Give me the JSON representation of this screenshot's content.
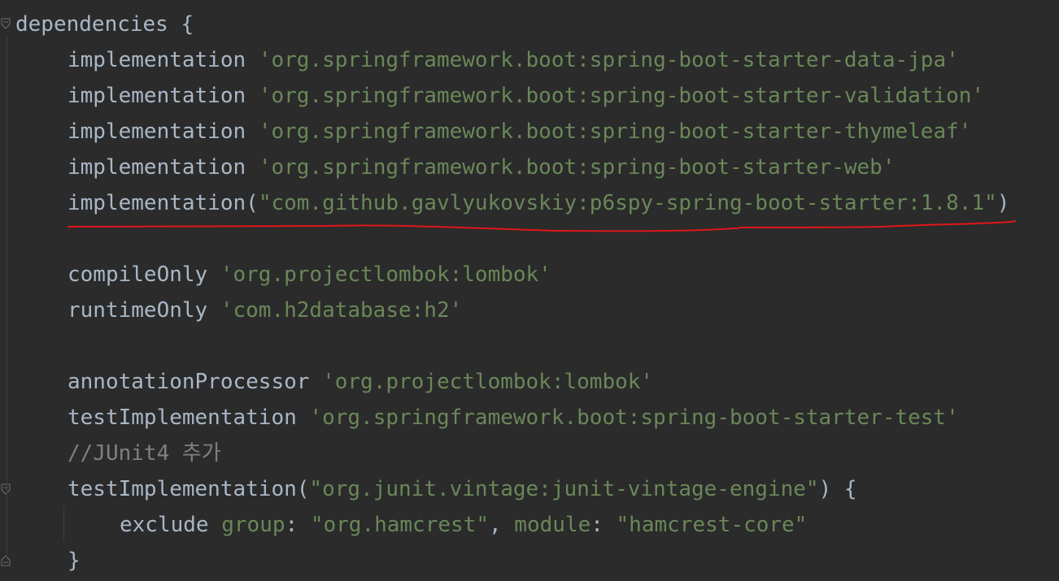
{
  "code": {
    "line1": {
      "ident": "dependencies",
      "brace": " {"
    },
    "deps": [
      {
        "fn": "implementation",
        "str": "'org.springframework.boot:spring-boot-starter-data-jpa'"
      },
      {
        "fn": "implementation",
        "str": "'org.springframework.boot:spring-boot-starter-validation'"
      },
      {
        "fn": "implementation",
        "str": "'org.springframework.boot:spring-boot-starter-thymeleaf'"
      },
      {
        "fn": "implementation",
        "str": "'org.springframework.boot:spring-boot-starter-web'"
      }
    ],
    "p6spy": {
      "fn": "implementation",
      "open": "(",
      "str": "\"com.github.gavlyukovskiy:p6spy-spring-boot-starter:1.8.1\"",
      "close": ")"
    },
    "compileOnly": {
      "fn": "compileOnly",
      "str": "'org.projectlombok:lombok'"
    },
    "runtimeOnly": {
      "fn": "runtimeOnly",
      "str": "'com.h2database:h2'"
    },
    "annotationProcessor": {
      "fn": "annotationProcessor",
      "str": "'org.projectlombok:lombok'"
    },
    "testImpl": {
      "fn": "testImplementation",
      "str": "'org.springframework.boot:spring-boot-starter-test'"
    },
    "comment": "//JUnit4 추가",
    "testImplVintage": {
      "fn": "testImplementation",
      "open": "(",
      "str": "\"org.junit.vintage:junit-vintage-engine\"",
      "close": ") {"
    },
    "exclude": {
      "fn": "exclude",
      "group_key": "group",
      "colon1": ": ",
      "group_val": "\"org.hamcrest\"",
      "comma": ", ",
      "module_key": "module",
      "colon2": ": ",
      "module_val": "\"hamcrest-core\""
    },
    "close_inner": "}"
  },
  "colors": {
    "background": "#2b2b2b",
    "text": "#a9b7c6",
    "string": "#6a8759",
    "comment": "#808080",
    "annotation_underline": "#e0161a"
  },
  "icons": [
    "fold-open-icon",
    "fold-close-icon"
  ]
}
